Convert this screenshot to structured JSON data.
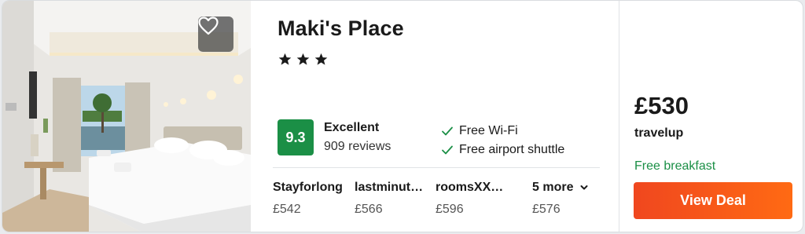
{
  "hotel": {
    "name": "Maki's Place",
    "stars": 3,
    "photo_alt": "Hotel room photo",
    "score": "9.3",
    "rating_label": "Excellent",
    "reviews": "909 reviews",
    "amenities": [
      "Free Wi-Fi",
      "Free airport shuttle"
    ]
  },
  "providers": [
    {
      "name": "Stayforlong",
      "price": "£542"
    },
    {
      "name": "lastminut…",
      "price": "£566"
    },
    {
      "name": "roomsXX…",
      "price": "£596"
    }
  ],
  "more": {
    "label": "5 more",
    "price": "£576"
  },
  "deal": {
    "price": "£530",
    "seller": "travelup",
    "perk": "Free breakfast",
    "button_label": "View Deal"
  },
  "colors": {
    "score_badge": "#1b8f46",
    "perk_text": "#1b8f46",
    "button_start": "#f0471f",
    "button_end": "#ff6a13"
  },
  "icons": [
    "heart-icon",
    "star-icon",
    "check-icon",
    "chevron-down-icon"
  ]
}
